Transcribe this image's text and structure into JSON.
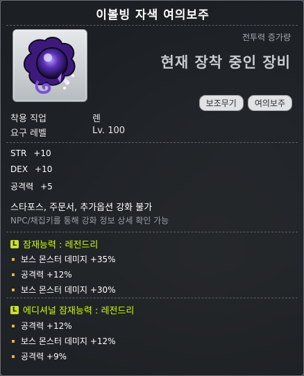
{
  "item": {
    "name": "이볼빙 자색 여의보주",
    "icon": "purple-orb-icon",
    "combat_power_label": "전투력 증가량",
    "equip_status": "현재 장착 중인 장비",
    "tags": [
      "보조무기",
      "여의보주"
    ],
    "job_label": "착용 직업",
    "job_value": "렌",
    "level_label": "요구 레벨",
    "level_value": "Lv. 100",
    "stats": [
      {
        "name": "STR",
        "value": "+10"
      },
      {
        "name": "DEX",
        "value": "+10"
      },
      {
        "name": "공격력",
        "value": "+5"
      }
    ],
    "enhance_notice": "스타포스, 주문서, 추가옵션 강화 불가",
    "npc_notice": "NPC/채집키를 통해 강화 정보 상세 확인 가능",
    "potential": {
      "title": "잠재능력 : 레전드리",
      "grade_icon": "L",
      "lines": [
        "보스 몬스터 데미지 +35%",
        "공격력 +12%",
        "보스 몬스터 데미지 +30%"
      ]
    },
    "additional_potential": {
      "title": "에디셔널 잠재능력 : 레전드리",
      "grade_icon": "L",
      "lines": [
        "공격력 +12%",
        "보스 몬스터 데미지 +12%",
        "공격력 +9%"
      ]
    },
    "colors": {
      "grade_legendary": "#c8e227",
      "potential_text": "#ccff00",
      "bullet": "#e7b431"
    }
  }
}
